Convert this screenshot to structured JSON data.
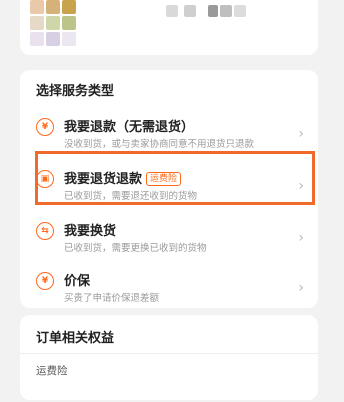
{
  "service": {
    "section_title": "选择服务类型",
    "options": [
      {
        "title": "我要退款（无需退货）",
        "subtitle": "没收到货，或与卖家协商同意不用退货只退款",
        "icon": "yen-icon",
        "badge": ""
      },
      {
        "title": "我要退货退款",
        "subtitle": "已收到货，需要退还收到的货物",
        "icon": "return-box-icon",
        "badge": "运费险"
      },
      {
        "title": "我要换货",
        "subtitle": "已收到货，需要更换已收到的货物",
        "icon": "exchange-icon",
        "badge": ""
      },
      {
        "title": "价保",
        "subtitle": "买贵了申请价保退差额",
        "icon": "price-shield-icon",
        "badge": ""
      }
    ]
  },
  "rights": {
    "section_title": "订单相关权益",
    "item": "运费险"
  },
  "colors": {
    "accent": "#ff6a1a",
    "highlight": "#f06a2c"
  }
}
